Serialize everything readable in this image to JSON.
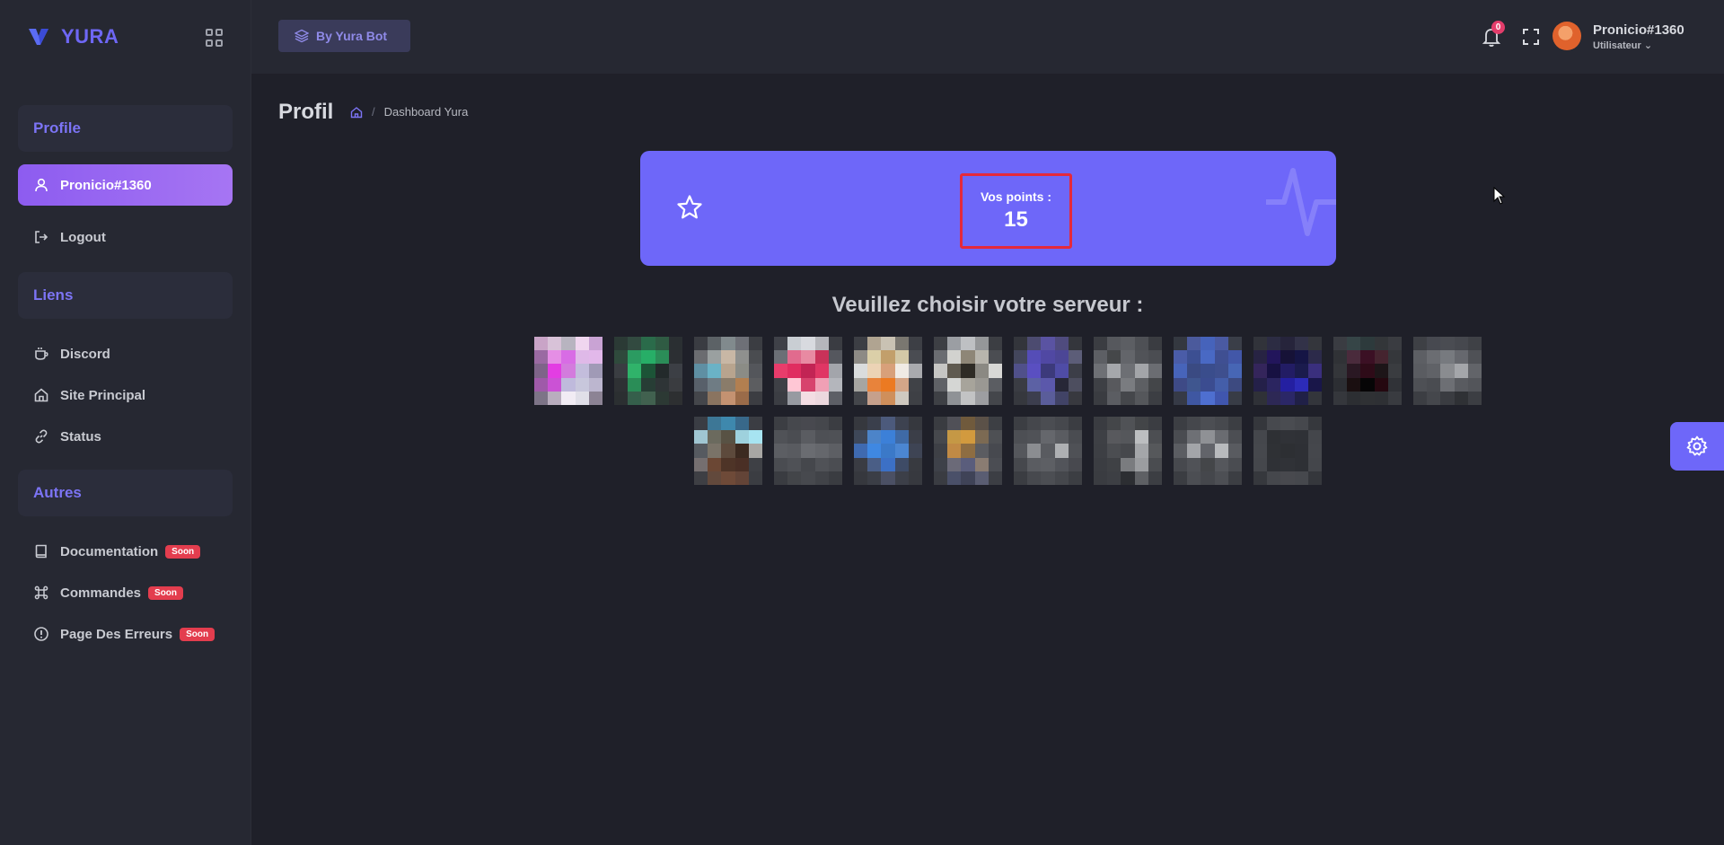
{
  "brand": {
    "name": "YURA",
    "color": "#6e67f5"
  },
  "sidebar": {
    "sections": [
      {
        "title": "Profile"
      },
      {
        "title": "Liens"
      },
      {
        "title": "Autres"
      }
    ],
    "profile_items": [
      {
        "label": "Pronicio#1360",
        "icon": "user-icon",
        "active": true
      },
      {
        "label": "Logout",
        "icon": "logout-icon"
      }
    ],
    "links_items": [
      {
        "label": "Discord",
        "icon": "cup-icon"
      },
      {
        "label": "Site Principal",
        "icon": "home-icon"
      },
      {
        "label": "Status",
        "icon": "link-icon"
      }
    ],
    "other_items": [
      {
        "label": "Documentation",
        "icon": "book-icon",
        "badge": "Soon"
      },
      {
        "label": "Commandes",
        "icon": "command-icon",
        "badge": "Soon"
      },
      {
        "label": "Page Des Erreurs",
        "icon": "alert-icon",
        "badge": "Soon"
      }
    ]
  },
  "header": {
    "bot_button": "By Yura Bot",
    "notifications_count": "0",
    "user": {
      "name": "Pronicio#1360",
      "role": "Utilisateur"
    }
  },
  "main": {
    "title": "Profil",
    "breadcrumb": "Dashboard Yura",
    "points": {
      "label": "Vos points :",
      "value": "15"
    },
    "choose_server": "Veuillez choisir votre serveur :"
  },
  "servers": [
    {
      "icon": "server-icon-blurred",
      "colors": [
        "#c9a4c7",
        "#d8c2d8",
        "#b8b4c0",
        "#f0d6ef",
        "#c9a3d4",
        "#9a6aa2",
        "#e58ee5",
        "#d86ce5",
        "#dfb9e8",
        "#e2b8ea",
        "#7e6489",
        "#e33de3",
        "#d37bdd",
        "#c3bddc",
        "#a09ab6",
        "#9f5aa9",
        "#cb52d5",
        "#bfbadc",
        "#c8c7dc",
        "#bcb6cf",
        "#7d7487",
        "#b9adbe",
        "#f1ecf4",
        "#e0dfe8",
        "#8c8394"
      ]
    },
    {
      "icon": "server-icon-blurred",
      "colors": [
        "#2b3a35",
        "#324a40",
        "#2a6b4a",
        "#2f5b43",
        "#2a2f32",
        "#2f4a3c",
        "#2b9b61",
        "#27ae67",
        "#2b8d58",
        "#2c2f33",
        "#3a3d42",
        "#30b36a",
        "#1c5437",
        "#232a2b",
        "#3c3f45",
        "#2e3134",
        "#2a8d57",
        "#273d35",
        "#2e3436",
        "#3a3c40",
        "#2b2f31",
        "#355f4b",
        "#41614f",
        "#2c3934",
        "#2d2f31"
      ]
    },
    {
      "icon": "server-icon-blurred",
      "colors": [
        "#3a3c42",
        "#5c6266",
        "#818a8d",
        "#6e7077",
        "#3b3d42",
        "#6b6c70",
        "#9aa0a0",
        "#c8b7a5",
        "#8f908e",
        "#4a4c50",
        "#5f8fa3",
        "#6ab2c6",
        "#b8a48e",
        "#8b8c86",
        "#54565b",
        "#58606a",
        "#6f7c84",
        "#8a7c6a",
        "#b27f50",
        "#5c5d60",
        "#44464b",
        "#8a7460",
        "#c49271",
        "#9a6b49",
        "#3c3d42"
      ]
    },
    {
      "icon": "server-icon-blurred",
      "colors": [
        "#3f4148",
        "#c9ced3",
        "#d8dadf",
        "#b5b6bb",
        "#3a3c42",
        "#6b6f76",
        "#e16b8e",
        "#e88aa2",
        "#c93259",
        "#55575e",
        "#e83c6b",
        "#e02d60",
        "#c22454",
        "#e03664",
        "#a3a5ab",
        "#3e4046",
        "#ffc7d5",
        "#d7436d",
        "#f0a0b5",
        "#b4b6bc",
        "#3b3d43",
        "#979aa1",
        "#f3dde3",
        "#ecd8de",
        "#5d5f66"
      ]
    },
    {
      "icon": "server-icon-blurred",
      "colors": [
        "#3c3e44",
        "#b0a491",
        "#c9c2b3",
        "#7a7770",
        "#3d3f45",
        "#8d8a85",
        "#dbcfa8",
        "#c29f6b",
        "#d3c8a7",
        "#4a4c52",
        "#dadcdd",
        "#ecd3b5",
        "#d8a07a",
        "#f0ebe5",
        "#a9aaae",
        "#a6a5a1",
        "#e8833b",
        "#ec7a22",
        "#d4a688",
        "#404247",
        "#44464b",
        "#c6a08c",
        "#cf8f5b",
        "#cfc9c0",
        "#3e4045"
      ]
    },
    {
      "icon": "server-icon-blurred",
      "colors": [
        "#3d3f44",
        "#9b9ea3",
        "#bec0c3",
        "#959799",
        "#3c3e43",
        "#6a6c71",
        "#d2d2cf",
        "#8e8677",
        "#b8b5ad",
        "#4b4d52",
        "#c6c6c4",
        "#5f5a50",
        "#2e2b25",
        "#8b8983",
        "#d8d8d6",
        "#5f6166",
        "#d5d6d4",
        "#a7a49b",
        "#9a9893",
        "#5b5d62",
        "#3e4045",
        "#8f9296",
        "#c2c3c4",
        "#9d9ea1",
        "#44464b"
      ]
    },
    {
      "icon": "server-icon-blurred",
      "colors": [
        "#33353b",
        "#4c4b70",
        "#5a53a2",
        "#4f4b7e",
        "#34363c",
        "#43465c",
        "#554db7",
        "#5048a3",
        "#4c4696",
        "#5c5d78",
        "#50508a",
        "#5a4fc1",
        "#3c3a7b",
        "#4f4ca6",
        "#3c3e48",
        "#3a3c43",
        "#5c61a4",
        "#5b58ab",
        "#272737",
        "#4d4e5f",
        "#36383e",
        "#3c3e4e",
        "#5a5d9a",
        "#414366",
        "#38393f"
      ]
    },
    {
      "icon": "server-icon-blurred",
      "colors": [
        "#3b3d42",
        "#56585d",
        "#5c5e63",
        "#4e5055",
        "#3a3c41",
        "#5d5f64",
        "#454749",
        "#63656a",
        "#515358",
        "#4b4d52",
        "#6e7075",
        "#a5a7ab",
        "#6d6f74",
        "#a3a5a9",
        "#6b6d72",
        "#3e4045",
        "#58595d",
        "#7a7c80",
        "#5d5f63",
        "#444649",
        "#3a3c41",
        "#5b5d62",
        "#45474b",
        "#55575b",
        "#3c3e43"
      ]
    },
    {
      "icon": "server-icon-blurred",
      "colors": [
        "#343840",
        "#4b5a9c",
        "#4663bb",
        "#4a5aa2",
        "#3a3e48",
        "#4a5ca8",
        "#3c4f92",
        "#4969c4",
        "#3f4f92",
        "#4257a8",
        "#4764ba",
        "#3a4a82",
        "#3a4d8c",
        "#3e4f8e",
        "#4766b5",
        "#3e4a86",
        "#3f568f",
        "#3b4c90",
        "#445ea9",
        "#3d4a80",
        "#363a46",
        "#3f57a2",
        "#4e6fd0",
        "#4056ae",
        "#383c46"
      ]
    },
    {
      "icon": "server-icon-blurred",
      "colors": [
        "#31333a",
        "#2c2c43",
        "#26243b",
        "#323248",
        "#34363c",
        "#272343",
        "#22155b",
        "#161237",
        "#151545",
        "#2c2a4a",
        "#34255b",
        "#171142",
        "#221c64",
        "#1a1b4d",
        "#3a2f7d",
        "#242049",
        "#2b2560",
        "#241fa1",
        "#2c2bb8",
        "#191649",
        "#2f3137",
        "#2d2855",
        "#2b2767",
        "#202047",
        "#33353b"
      ]
    },
    {
      "icon": "server-icon-blurred",
      "colors": [
        "#3a3c42",
        "#364547",
        "#2d3a3c",
        "#333639",
        "#3a3c41",
        "#303236",
        "#4a2b3c",
        "#3b1024",
        "#45242f",
        "#35373b",
        "#34363a",
        "#2a1823",
        "#2e0b18",
        "#1d1518",
        "#3a3c40",
        "#2c2e33",
        "#1a0f10",
        "#060506",
        "#250810",
        "#303237",
        "#35373c",
        "#2c2e32",
        "#2f3134",
        "#2e3034",
        "#393b40"
      ]
    },
    {
      "icon": "server-icon-blurred",
      "colors": [
        "#3e4045",
        "#474950",
        "#4a4c52",
        "#46484e",
        "#3f4146",
        "#5d5f64",
        "#6b6d72",
        "#777a7f",
        "#66686e",
        "#4f5156",
        "#5a5c61",
        "#606267",
        "#8a8c90",
        "#a4a6aa",
        "#626469",
        "#4e5055",
        "#4a4c51",
        "#6d6f74",
        "#595b60",
        "#53555a",
        "#3c3e43",
        "#45474c",
        "#3a3c41",
        "#2f3135",
        "#3c3e43"
      ]
    },
    {
      "icon": "server-icon-blurred",
      "colors": [
        "#3a3d44",
        "#3d7796",
        "#3e88ad",
        "#38688a",
        "#3b3d43",
        "#a0c6d2",
        "#6b6a5e",
        "#585244",
        "#9ed1dd",
        "#a7e4f1",
        "#565a60",
        "#7a7368",
        "#5d4a3c",
        "#3c2a20",
        "#a8a7a4",
        "#756f70",
        "#6b4734",
        "#4e3427",
        "#4a2f25",
        "#3e4045",
        "#3e3f44",
        "#62493c",
        "#6e4a38",
        "#634437",
        "#3b3d42"
      ]
    },
    {
      "icon": "server-icon-blurred",
      "colors": [
        "#3c3e43",
        "#46484d",
        "#48494f",
        "#45474c",
        "#3b3d42",
        "#505257",
        "#4b4d52",
        "#5a5c61",
        "#4e5055",
        "#4f5156",
        "#5c5e63",
        "#595b60",
        "#6a6c71",
        "#65676c",
        "#5d5f64",
        "#4a4c51",
        "#4f5156",
        "#45474c",
        "#505257",
        "#4b4d52",
        "#3a3c41",
        "#434549",
        "#47494e",
        "#414348",
        "#3a3c41"
      ]
    },
    {
      "icon": "server-icon-blurred",
      "colors": [
        "#36383e",
        "#3a3f4c",
        "#4c5a7c",
        "#3d4250",
        "#36383e",
        "#3e4758",
        "#4c84c9",
        "#3c80d8",
        "#3f6aa6",
        "#3b3e48",
        "#3f6ab0",
        "#3f88e2",
        "#3b79c8",
        "#4b86d2",
        "#3e4454",
        "#3a3c43",
        "#4a5e86",
        "#3c70c6",
        "#3e4b66",
        "#383a40",
        "#36383e",
        "#3b3e46",
        "#4b5064",
        "#3c3f48",
        "#37393f"
      ]
    },
    {
      "icon": "server-icon-blurred",
      "colors": [
        "#3a3c41",
        "#505057",
        "#705a3c",
        "#5b5148",
        "#3d3f44",
        "#46484d",
        "#c59845",
        "#d29a3e",
        "#7c6a53",
        "#4e5054",
        "#3e4046",
        "#c18a45",
        "#8e6d42",
        "#5b5c61",
        "#47494f",
        "#3e4149",
        "#6b6a78",
        "#5a5d7c",
        "#8a7c72",
        "#4b4d53",
        "#3a3c42",
        "#4a5069",
        "#3f4357",
        "#5a5d72",
        "#3c3e44"
      ]
    },
    {
      "icon": "server-icon-blurred",
      "colors": [
        "#3c3e43",
        "#45474c",
        "#4b4d52",
        "#46484d",
        "#3b3d42",
        "#4d4f54",
        "#505257",
        "#65676c",
        "#5a5c61",
        "#4a4c51",
        "#55575c",
        "#8b8d91",
        "#595b60",
        "#aeb0b3",
        "#4f5156",
        "#46484d",
        "#5a5c61",
        "#5d5f64",
        "#52545a",
        "#48494f",
        "#3b3d42",
        "#47494e",
        "#4c4e53",
        "#45474c",
        "#3c3e43"
      ]
    },
    {
      "icon": "server-icon-blurred",
      "colors": [
        "#3a3c41",
        "#444649",
        "#505256",
        "#434548",
        "#3b3d42",
        "#3e4045",
        "#58595d",
        "#55575b",
        "#bcbec0",
        "#4c4e52",
        "#3d3f44",
        "#4b4d51",
        "#46484c",
        "#a4a6a9",
        "#56585b",
        "#3b3d42",
        "#3f4145",
        "#7a7c7f",
        "#9b9da0",
        "#4a4c50",
        "#3a3c41",
        "#3d3f44",
        "#2c2e32",
        "#5e6064",
        "#3c3e43"
      ]
    },
    {
      "icon": "server-icon-blurred",
      "colors": [
        "#3c3e43",
        "#45474c",
        "#4c4e53",
        "#47494e",
        "#3c3e43",
        "#4a4c51",
        "#6e7075",
        "#8f9195",
        "#6a6c71",
        "#4c4e53",
        "#5b5d62",
        "#a3a5a9",
        "#62646a",
        "#b8babd",
        "#595b60",
        "#47494e",
        "#505257",
        "#444649",
        "#55575c",
        "#4a4c51",
        "#3b3d42",
        "#4c4e53",
        "#45474c",
        "#4d4f54",
        "#3c3e43"
      ]
    },
    {
      "icon": "server-icon-blurred",
      "colors": [
        "#35373c",
        "#47494e",
        "#4a4c51",
        "#46484d",
        "#36383d",
        "#45474c",
        "#2e3034",
        "#303237",
        "#2f3136",
        "#44464b",
        "#46484d",
        "#2f3135",
        "#2d2f33",
        "#2e3035",
        "#45474c",
        "#45474c",
        "#2f3136",
        "#303237",
        "#2e3035",
        "#44464b",
        "#36383d",
        "#45474c",
        "#48494e",
        "#46484d",
        "#35373c"
      ]
    }
  ]
}
